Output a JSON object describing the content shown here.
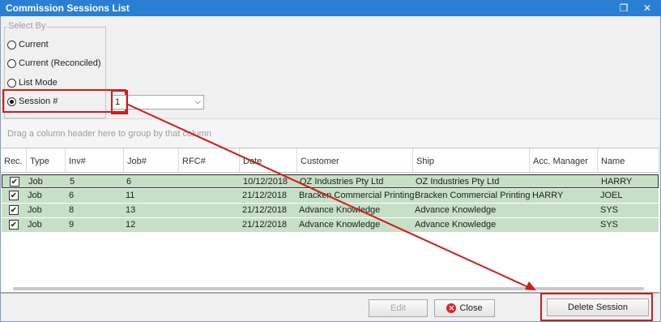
{
  "window": {
    "title": "Commission Sessions List",
    "restore_icon": "restore-icon",
    "close_icon": "close-icon"
  },
  "select_by": {
    "label": "Select By",
    "options": [
      {
        "label": "Current",
        "checked": false
      },
      {
        "label": "Current (Reconciled)",
        "checked": false
      },
      {
        "label": "List Mode",
        "checked": false
      },
      {
        "label": "Session #",
        "checked": true
      }
    ],
    "session_value": "1"
  },
  "group_panel_text": "Drag a column header here to group by that column",
  "grid": {
    "columns": [
      "Rec.",
      "Type",
      "Inv#",
      "Job#",
      "RFC#",
      "Date",
      "Customer",
      "Ship",
      "Acc. Manager",
      "Name"
    ],
    "rows": [
      {
        "rec": true,
        "type": "Job",
        "inv": "5",
        "job": "6",
        "rfc": "",
        "date": "10/12/2018",
        "customer": "OZ Industries Pty Ltd",
        "ship": "OZ Industries Pty Ltd",
        "acc_manager": "",
        "name": "HARRY"
      },
      {
        "rec": true,
        "type": "Job",
        "inv": "6",
        "job": "11",
        "rfc": "",
        "date": "21/12/2018",
        "customer": "Bracken Commercial Printing",
        "ship": "Bracken Commercial Printing",
        "acc_manager": "HARRY",
        "name": "JOEL"
      },
      {
        "rec": true,
        "type": "Job",
        "inv": "8",
        "job": "13",
        "rfc": "",
        "date": "21/12/2018",
        "customer": "Advance Knowledge",
        "ship": "Advance Knowledge",
        "acc_manager": "",
        "name": "SYS"
      },
      {
        "rec": true,
        "type": "Job",
        "inv": "9",
        "job": "12",
        "rfc": "",
        "date": "21/12/2018",
        "customer": "Advance Knowledge",
        "ship": "Advance Knowledge",
        "acc_manager": "",
        "name": "SYS"
      }
    ],
    "row_color": "#c6e0c6"
  },
  "buttons": {
    "edit": "Edit",
    "close": "Close",
    "delete_session": "Delete Session"
  },
  "annotation_color": "#d01c1c",
  "accent_color": "#2b7fd3"
}
